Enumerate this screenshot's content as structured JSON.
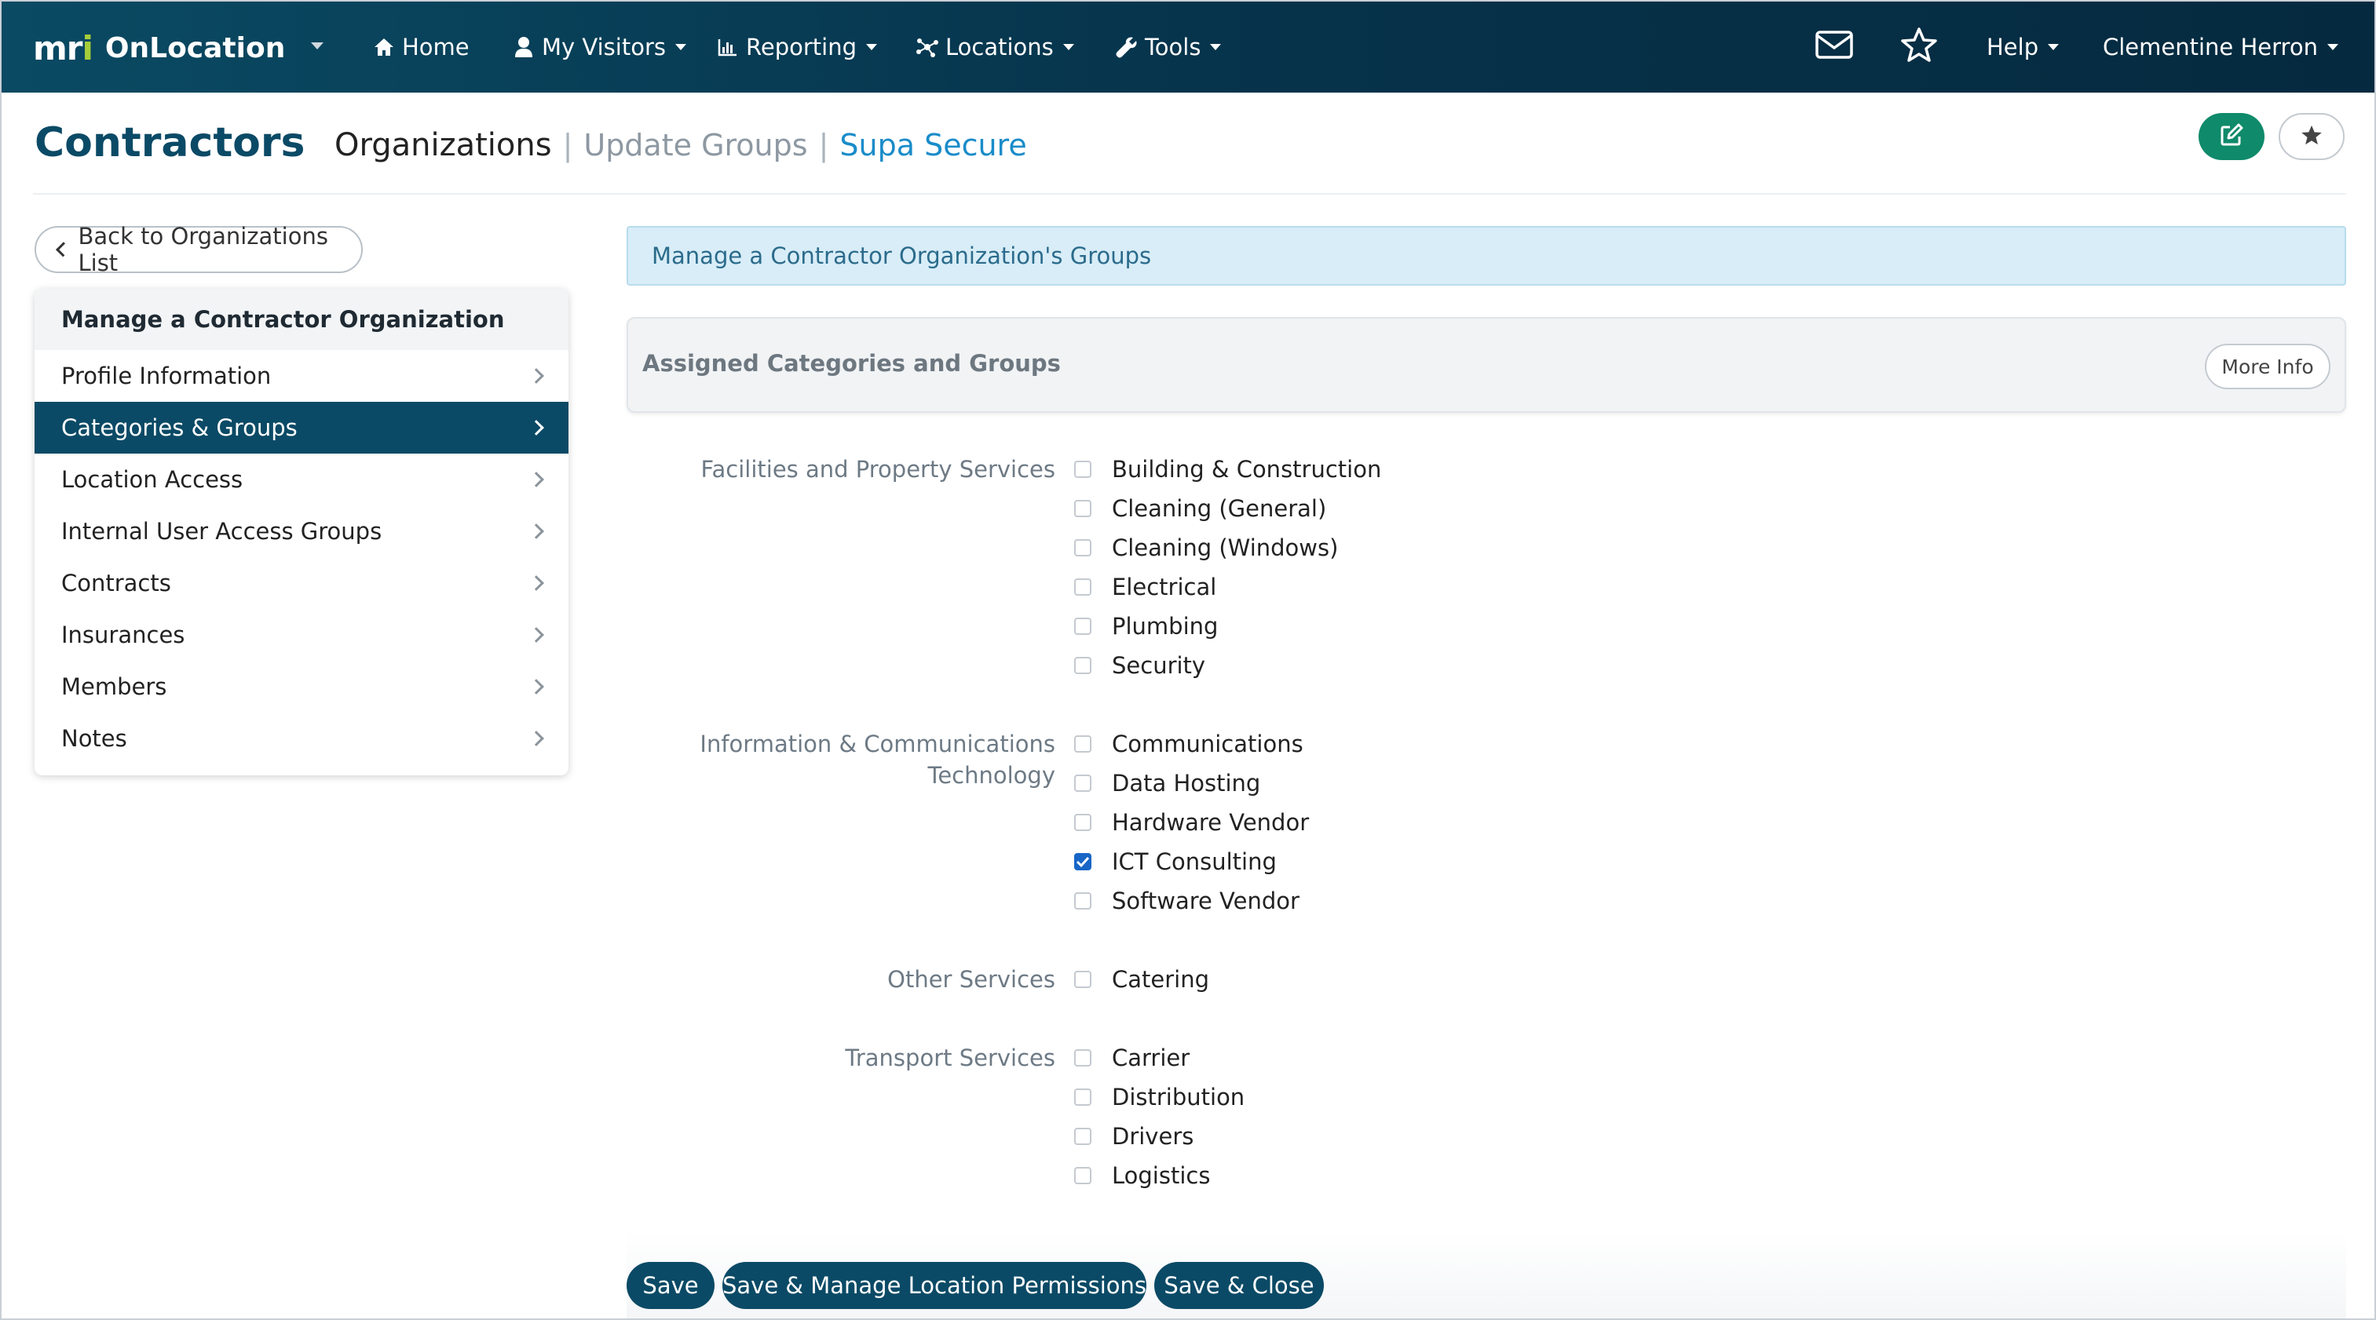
{
  "app": {
    "logo_text": "mri",
    "name": "OnLocation"
  },
  "nav": {
    "items": [
      {
        "label": "Home",
        "icon": "home-icon"
      },
      {
        "label": "My Visitors",
        "icon": "user-icon"
      },
      {
        "label": "Reporting",
        "icon": "bar-chart-icon"
      },
      {
        "label": "Locations",
        "icon": "network-icon"
      },
      {
        "label": "Tools",
        "icon": "wrench-icon"
      }
    ],
    "help_label": "Help",
    "user_name": "Clementine Herron",
    "mail_icon": "envelope-icon",
    "favorites_icon": "star-icon"
  },
  "header": {
    "title": "Contractors",
    "breadcrumb": {
      "current": "Organizations",
      "step": "Update Groups",
      "entity": "Supa Secure"
    },
    "edit_icon": "edit-icon",
    "favorite_icon": "star-icon"
  },
  "sidebar": {
    "back_label": "Back to Organizations List",
    "menu_title": "Manage a Contractor Organization",
    "items": [
      {
        "label": "Profile Information"
      },
      {
        "label": "Categories & Groups",
        "active": true
      },
      {
        "label": "Location Access"
      },
      {
        "label": "Internal User Access Groups"
      },
      {
        "label": "Contracts"
      },
      {
        "label": "Insurances"
      },
      {
        "label": "Members"
      },
      {
        "label": "Notes"
      }
    ]
  },
  "main": {
    "info_text": "Manage a Contractor Organization's Groups",
    "section_title": "Assigned Categories and Groups",
    "more_info_label": "More Info",
    "categories": [
      {
        "label_lines": [
          "Facilities and Property Services"
        ],
        "options": [
          {
            "label": "Building & Construction",
            "checked": false
          },
          {
            "label": "Cleaning (General)",
            "checked": false
          },
          {
            "label": "Cleaning (Windows)",
            "checked": false
          },
          {
            "label": "Electrical",
            "checked": false
          },
          {
            "label": "Plumbing",
            "checked": false
          },
          {
            "label": "Security",
            "checked": false
          }
        ]
      },
      {
        "label_lines": [
          "Information & Communications",
          "Technology"
        ],
        "options": [
          {
            "label": "Communications",
            "checked": false
          },
          {
            "label": "Data Hosting",
            "checked": false
          },
          {
            "label": "Hardware Vendor",
            "checked": false
          },
          {
            "label": "ICT Consulting",
            "checked": true
          },
          {
            "label": "Software Vendor",
            "checked": false
          }
        ]
      },
      {
        "label_lines": [
          "Other Services"
        ],
        "options": [
          {
            "label": "Catering",
            "checked": false
          }
        ]
      },
      {
        "label_lines": [
          "Transport Services"
        ],
        "options": [
          {
            "label": "Carrier",
            "checked": false
          },
          {
            "label": "Distribution",
            "checked": false
          },
          {
            "label": "Drivers",
            "checked": false
          },
          {
            "label": "Logistics",
            "checked": false
          }
        ]
      }
    ]
  },
  "actions": {
    "save": "Save",
    "save_manage": "Save & Manage Location Permissions",
    "save_close": "Save & Close"
  },
  "colors": {
    "nav_bg": "#06324a",
    "primary": "#0b4a66",
    "accent_green": "#0f8a6a",
    "link_blue": "#1a8cc9",
    "checkbox_checked": "#1766c7"
  }
}
